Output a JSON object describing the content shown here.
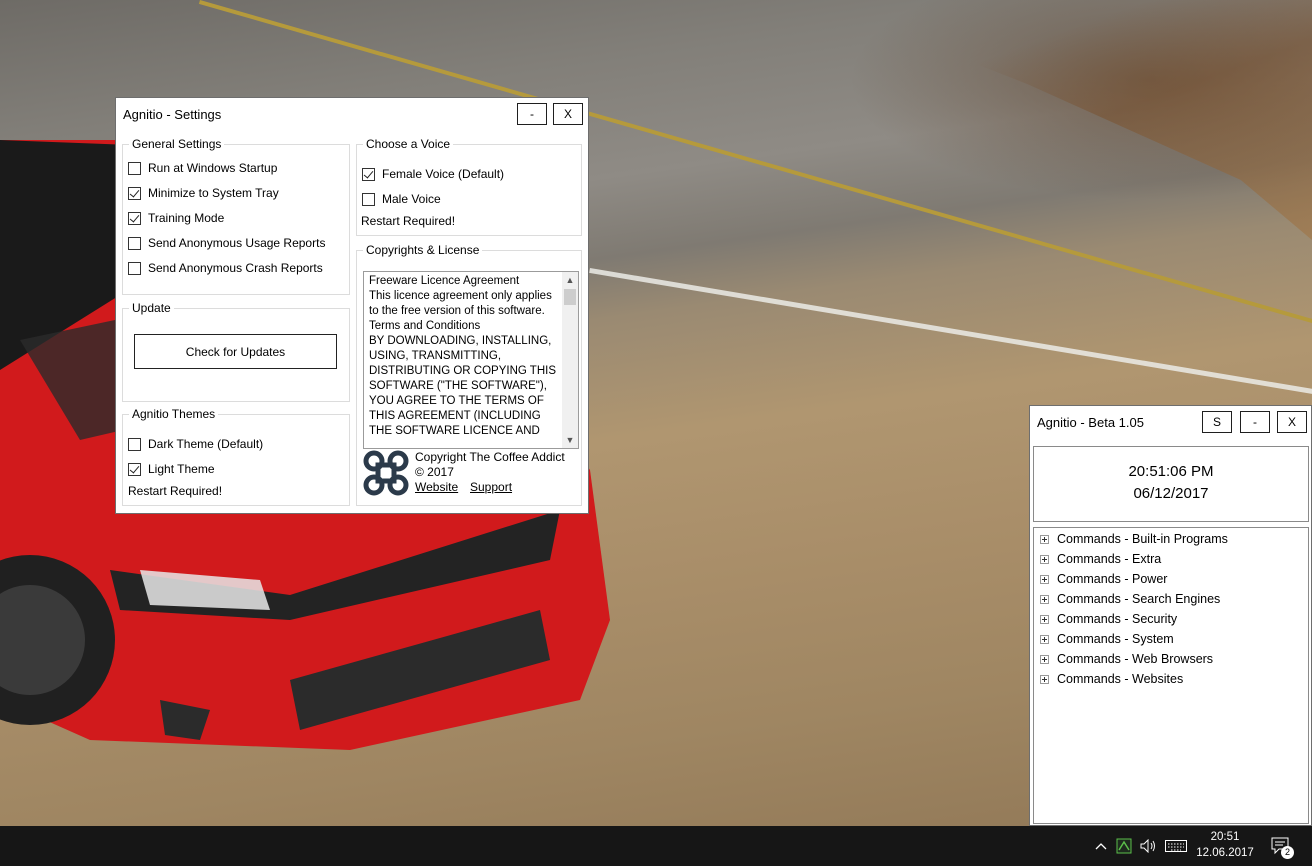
{
  "settings_window": {
    "title": "Agnitio - Settings",
    "minimize_label": "-",
    "close_label": "X",
    "general": {
      "legend": "General Settings",
      "items": [
        {
          "label": "Run at Windows Startup",
          "checked": false
        },
        {
          "label": "Minimize to System Tray",
          "checked": true
        },
        {
          "label": "Training Mode",
          "checked": true
        },
        {
          "label": "Send Anonymous Usage Reports",
          "checked": false
        },
        {
          "label": "Send Anonymous Crash Reports",
          "checked": false
        }
      ]
    },
    "update": {
      "legend": "Update",
      "button_label": "Check for Updates"
    },
    "themes": {
      "legend": "Agnitio Themes",
      "items": [
        {
          "label": "Dark Theme (Default)",
          "checked": false
        },
        {
          "label": "Light Theme",
          "checked": true
        }
      ],
      "note": "Restart Required!"
    },
    "voice": {
      "legend": "Choose a Voice",
      "items": [
        {
          "label": "Female Voice (Default)",
          "checked": true
        },
        {
          "label": "Male Voice",
          "checked": false
        }
      ],
      "note": "Restart Required!"
    },
    "license": {
      "legend": "Copyrights & License",
      "lines": [
        "Freeware Licence Agreement",
        "This licence agreement only applies",
        "to the free version of this software.",
        "Terms and Conditions",
        "BY DOWNLOADING, INSTALLING,",
        "USING, TRANSMITTING,",
        "DISTRIBUTING OR COPYING THIS",
        "SOFTWARE (\"THE SOFTWARE\"),",
        "YOU AGREE TO THE TERMS OF",
        "THIS AGREEMENT (INCLUDING",
        "THE SOFTWARE LICENCE AND"
      ],
      "copyright_line1": "Copyright The Coffee Addict",
      "copyright_line2": "© 2017",
      "website_link": "Website",
      "support_link": "Support"
    }
  },
  "main_window": {
    "title": "Agnitio -  Beta 1.05",
    "s_label": "S",
    "minimize_label": "-",
    "close_label": "X",
    "time": "20:51:06 PM",
    "date": "06/12/2017",
    "tree": [
      "Commands - Built-in Programs",
      "Commands - Extra",
      "Commands - Power",
      "Commands - Search Engines",
      "Commands - Security",
      "Commands - System",
      "Commands - Web Browsers",
      "Commands - Websites"
    ]
  },
  "taskbar": {
    "time": "20:51",
    "date": "12.06.2017",
    "notification_count": "2",
    "icons": [
      "chevron-up-icon",
      "agnitio-tray-icon",
      "speaker-icon",
      "keyboard-icon",
      "action-center-icon"
    ]
  }
}
